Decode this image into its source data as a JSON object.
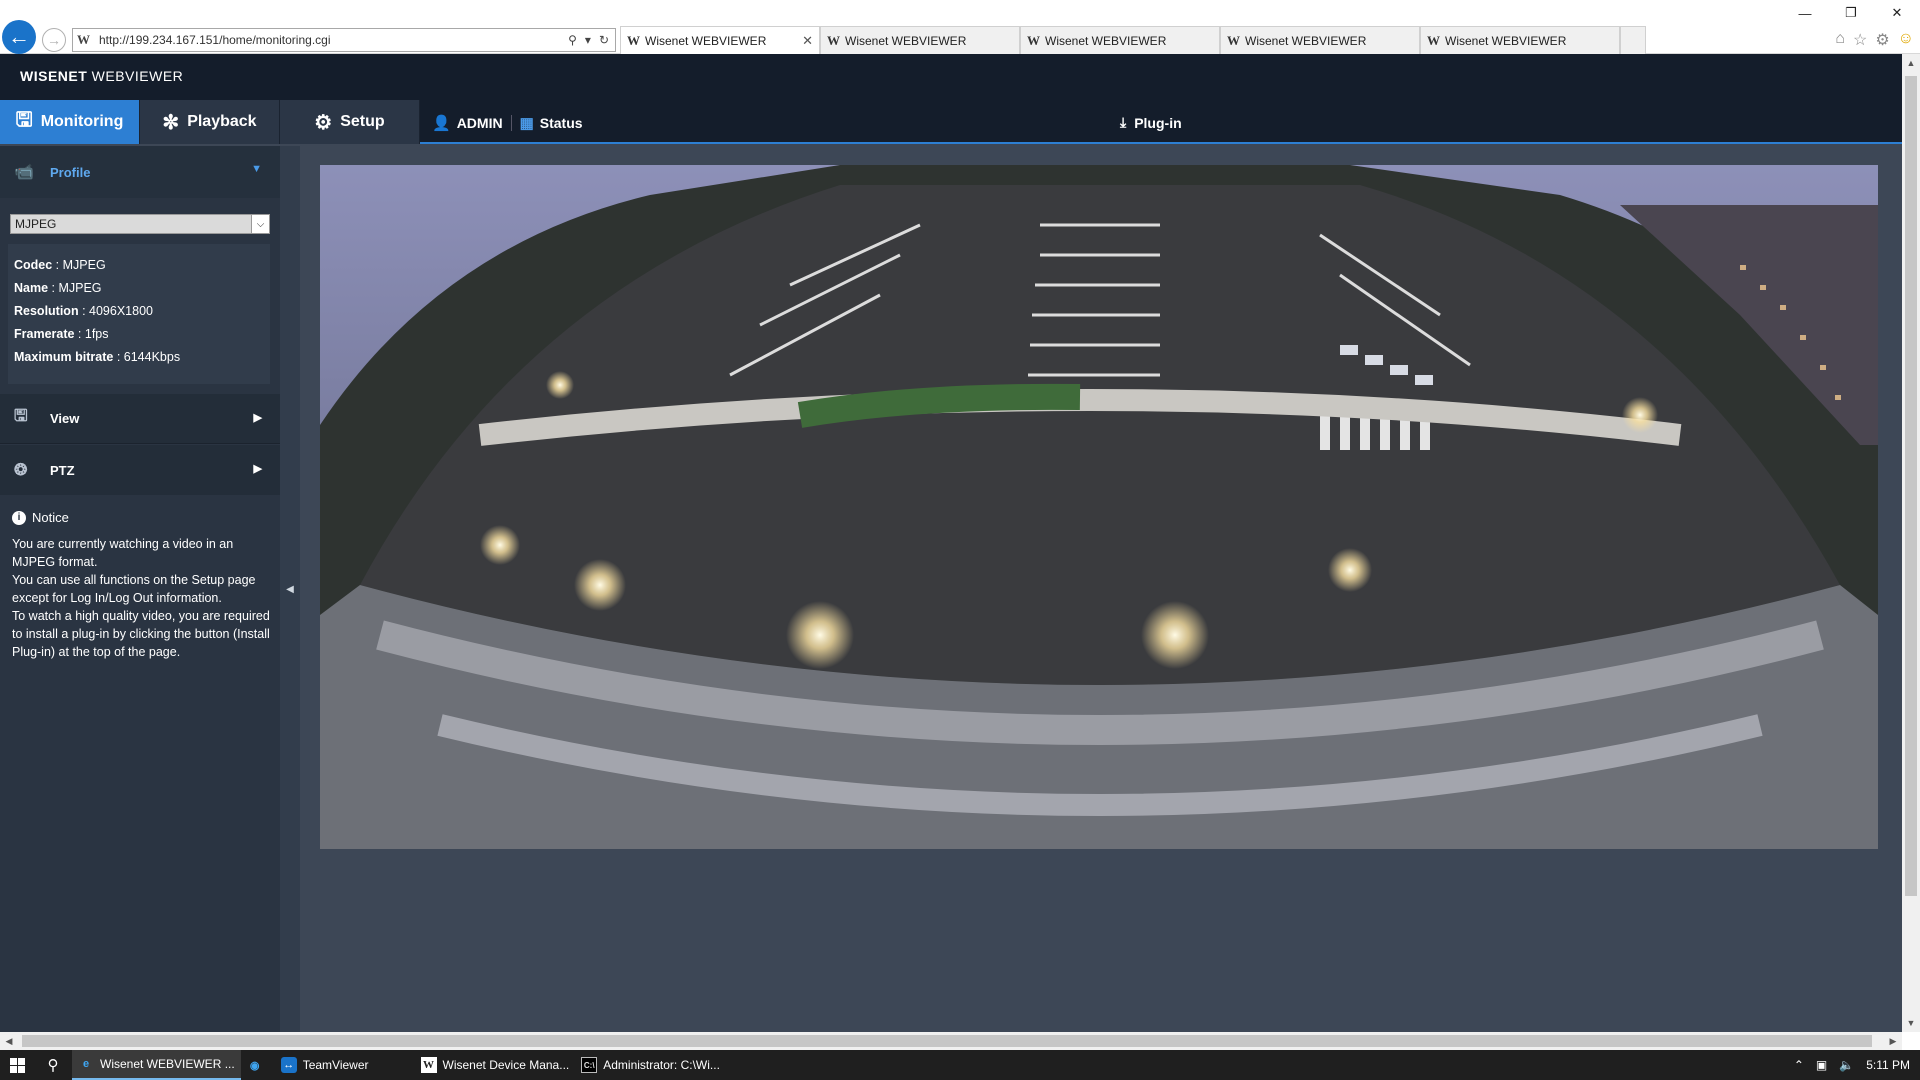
{
  "browser": {
    "url": "http://199.234.167.151/home/monitoring.cgi",
    "tabs": [
      {
        "title": "Wisenet WEBVIEWER",
        "active": true
      },
      {
        "title": "Wisenet WEBVIEWER",
        "active": false
      },
      {
        "title": "Wisenet WEBVIEWER",
        "active": false
      },
      {
        "title": "Wisenet WEBVIEWER",
        "active": false
      },
      {
        "title": "Wisenet WEBVIEWER",
        "active": false
      }
    ]
  },
  "app": {
    "brand_bold": "WISENET",
    "brand_rest": " WEBVIEWER",
    "nav": {
      "monitoring": "Monitoring",
      "playback": "Playback",
      "setup": "Setup"
    },
    "user": "ADMIN",
    "status": "Status",
    "plugin": "Plug-in",
    "accent_color": "#2d7fd3"
  },
  "sidebar": {
    "profile_label": "Profile",
    "profile_selected": "MJPEG",
    "info": {
      "codec_label": "Codec",
      "codec_value": "MJPEG",
      "name_label": "Name",
      "name_value": "MJPEG",
      "resolution_label": "Resolution",
      "resolution_value": "4096X1800",
      "framerate_label": "Framerate",
      "framerate_value": "1fps",
      "bitrate_label": "Maximum bitrate",
      "bitrate_value": "6144Kbps"
    },
    "view_label": "View",
    "ptz_label": "PTZ",
    "notice_title": "Notice",
    "notice_lines": [
      "You are currently watching a video in an MJPEG format.",
      "You can use all functions on the Setup page except for Log In/Log Out information.",
      "To watch a high quality video, you are required to install a plug-in by clicking the button (Install Plug-in) at the top of the page."
    ]
  },
  "taskbar": {
    "items": [
      "Wisenet WEBVIEWER ...",
      "TeamViewer",
      "Wisenet Device Mana...",
      "Administrator: C:\\Wi..."
    ],
    "time": "5:11 PM"
  }
}
